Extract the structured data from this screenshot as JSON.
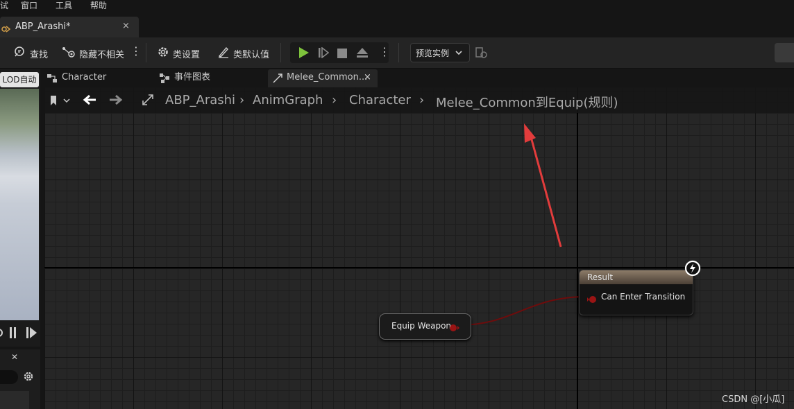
{
  "menu": {
    "items": [
      "试",
      "窗口",
      "工具",
      "帮助"
    ]
  },
  "document_tab": {
    "title": "ABP_Arashi*",
    "close": "×"
  },
  "toolbar": {
    "find_label": "查找",
    "hide_unrelated_label": "隐藏不相关",
    "class_settings_label": "类设置",
    "class_defaults_label": "类默认值",
    "preview_instance_label": "预览实例",
    "play_color": "#7ec33c"
  },
  "viewport": {
    "lod_label": "LOD自动"
  },
  "graph_tabs": [
    {
      "label": "Character"
    },
    {
      "label": "事件图表"
    },
    {
      "label": "Melee_Common...",
      "close": "×"
    }
  ],
  "breadcrumb": {
    "items": [
      "ABP_Arashi",
      "AnimGraph",
      "Character",
      "Melee_Common到Equip(规则)"
    ]
  },
  "nodes": {
    "equip_weapon": {
      "label": "Equip Weapon"
    },
    "result": {
      "title": "Result",
      "pin_label": "Can Enter Transition"
    }
  },
  "colors": {
    "boolean_pin": "#9a1414",
    "wire": "#6e0c0c",
    "annotation_arrow": "#e23c3c"
  },
  "watermark": {
    "text": "CSDN @[小瓜]"
  }
}
